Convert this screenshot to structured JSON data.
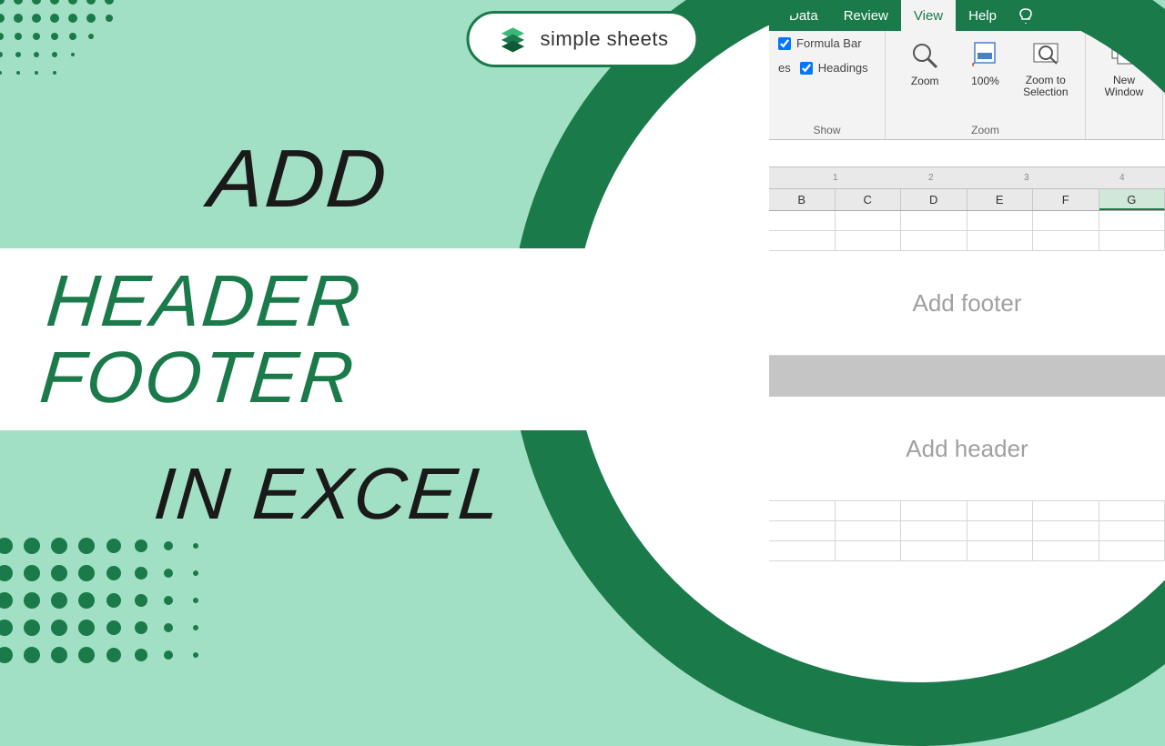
{
  "logo": {
    "text": "simple sheets"
  },
  "headline": {
    "l1": "ADD",
    "l2": "HEADER FOOTER",
    "l3": "IN EXCEL"
  },
  "ribbon": {
    "tabs": [
      "Data",
      "Review",
      "View",
      "Help"
    ],
    "active": "View",
    "show": {
      "cut_label": "es",
      "formula_bar": "Formula Bar",
      "headings": "Headings",
      "group": "Show"
    },
    "zoom": {
      "zoom": "Zoom",
      "hundred": "100%",
      "zoom_sel_1": "Zoom to",
      "zoom_sel_2": "Selection",
      "group": "Zoom"
    },
    "window": {
      "new_1": "New",
      "new_2": "Window"
    }
  },
  "columns": [
    "B",
    "C",
    "D",
    "E",
    "F",
    "G"
  ],
  "ruler_numbers": [
    "1",
    "2",
    "3",
    "4"
  ],
  "hf": {
    "footer": "Add footer",
    "header": "Add header"
  }
}
